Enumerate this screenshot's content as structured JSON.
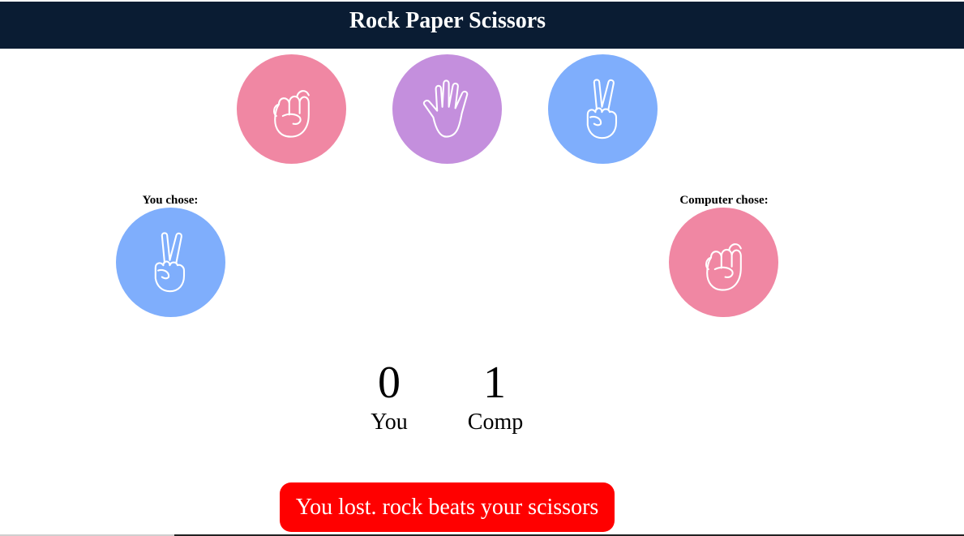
{
  "app": {
    "title": "Rock Paper Scissors"
  },
  "colors": {
    "header_bg": "#0a1c33",
    "rock": "#f087a3",
    "paper": "#c48fdd",
    "scissors": "#7faefc",
    "result_bg": "#ff0000"
  },
  "choices": [
    {
      "name": "rock",
      "icon": "fist-icon"
    },
    {
      "name": "paper",
      "icon": "open-hand-icon"
    },
    {
      "name": "scissors",
      "icon": "peace-hand-icon"
    }
  ],
  "player": {
    "label": "You chose:",
    "choice": "scissors"
  },
  "computer": {
    "label": "Computer chose:",
    "choice": "rock"
  },
  "score": {
    "you_value": "0",
    "you_label": "You",
    "comp_value": "1",
    "comp_label": "Comp"
  },
  "result": {
    "message": "You lost. rock beats your scissors"
  }
}
